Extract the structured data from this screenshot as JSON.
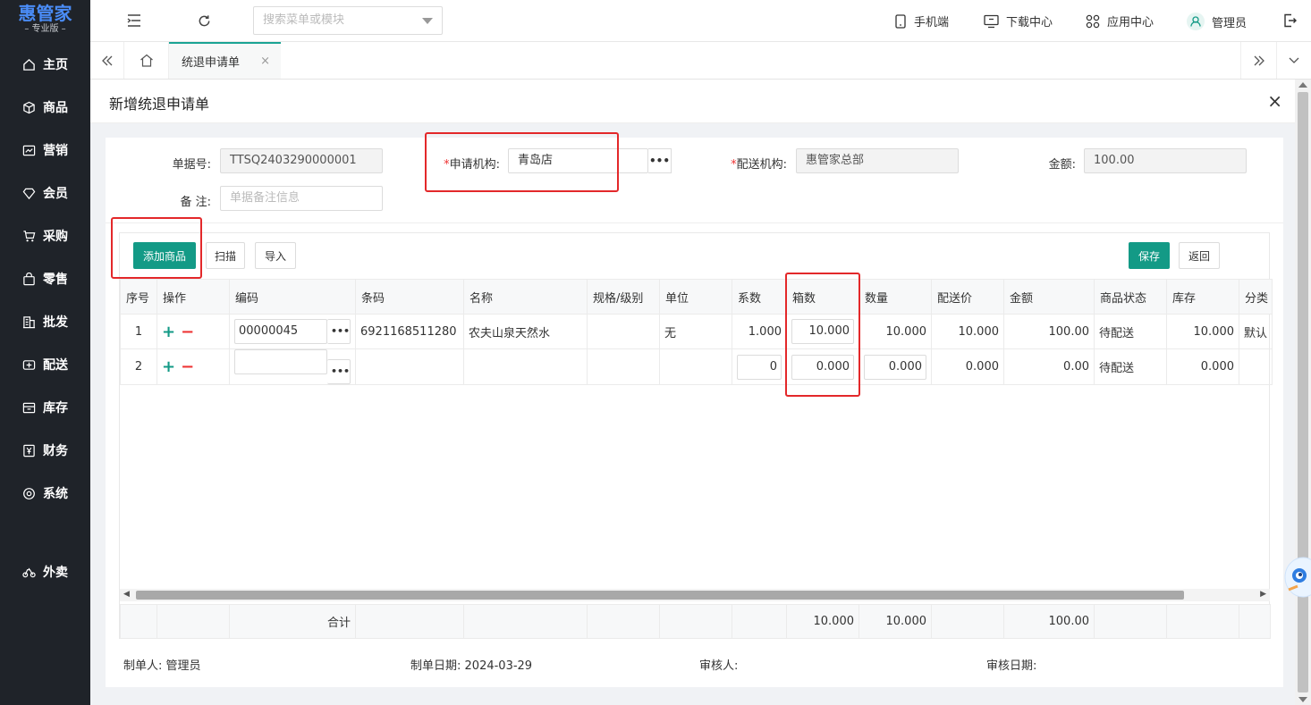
{
  "logo": {
    "main": "惠管家",
    "sub": "– 专业版 –"
  },
  "sidebar": {
    "items": [
      {
        "label": "主页",
        "icon": "home-icon"
      },
      {
        "label": "商品",
        "icon": "cube-icon"
      },
      {
        "label": "营销",
        "icon": "chart-icon"
      },
      {
        "label": "会员",
        "icon": "diamond-icon"
      },
      {
        "label": "采购",
        "icon": "cart-icon"
      },
      {
        "label": "零售",
        "icon": "bag-icon"
      },
      {
        "label": "批发",
        "icon": "building-icon"
      },
      {
        "label": "配送",
        "icon": "truck-icon"
      },
      {
        "label": "库存",
        "icon": "box-icon"
      },
      {
        "label": "财务",
        "icon": "yen-icon"
      },
      {
        "label": "系统",
        "icon": "gear-icon"
      },
      {
        "label": "外卖",
        "icon": "bike-icon"
      }
    ]
  },
  "topbar": {
    "search_placeholder": "搜索菜单或模块",
    "mobile": "手机端",
    "download": "下载中心",
    "apps": "应用中心",
    "user": "管理员"
  },
  "tabs": [
    {
      "label": "统退申请单",
      "close": "×"
    }
  ],
  "dialog": {
    "title": "新增统退申请单",
    "close": "×"
  },
  "form": {
    "doc_no_label": "单据号:",
    "doc_no": "TTSQ2403290000001",
    "apply_org_req": "*",
    "apply_org_label": "申请机构:",
    "apply_org": "青岛店",
    "dist_org_req": "*",
    "dist_org_label": "配送机构:",
    "dist_org": "惠管家总部",
    "amount_label": "金额:",
    "amount": "100.00",
    "remark_label": "备 注:",
    "remark_placeholder": "单据备注信息"
  },
  "toolbar": {
    "add": "添加商品",
    "scan": "扫描",
    "import": "导入",
    "save": "保存",
    "back": "返回"
  },
  "grid": {
    "columns": [
      "序号",
      "操作",
      "编码",
      "条码",
      "名称",
      "规格/级别",
      "单位",
      "系数",
      "箱数",
      "数量",
      "配送价",
      "金额",
      "商品状态",
      "库存",
      "分类"
    ],
    "rows": [
      {
        "seq": "1",
        "code": "00000045",
        "barcode": "6921168511280",
        "name": "农夫山泉天然水",
        "spec": "",
        "unit": "无",
        "factor": "1.000",
        "boxes": "10.000",
        "qty": "10.000",
        "price": "10.000",
        "amount": "100.00",
        "status": "待配送",
        "stock": "10.000",
        "category": "默认"
      },
      {
        "seq": "2",
        "code": "",
        "barcode": "",
        "name": "",
        "spec": "",
        "unit": "",
        "factor": "0",
        "boxes": "0.000",
        "qty": "0.000",
        "price": "0.000",
        "amount": "0.00",
        "status": "待配送",
        "stock": "0.000",
        "category": ""
      }
    ],
    "totals": {
      "label": "合计",
      "boxes": "10.000",
      "qty": "10.000",
      "amount": "100.00"
    }
  },
  "footer": {
    "maker_label": "制单人:",
    "maker": "管理员",
    "date_label": "制单日期:",
    "date": "2024-03-29",
    "auditor_label": "审核人:",
    "auditor": "",
    "audit_date_label": "审核日期:",
    "audit_date": ""
  },
  "colors": {
    "accent": "#139a86",
    "highlight": "#e3282a",
    "sidebar": "#1f2329"
  }
}
